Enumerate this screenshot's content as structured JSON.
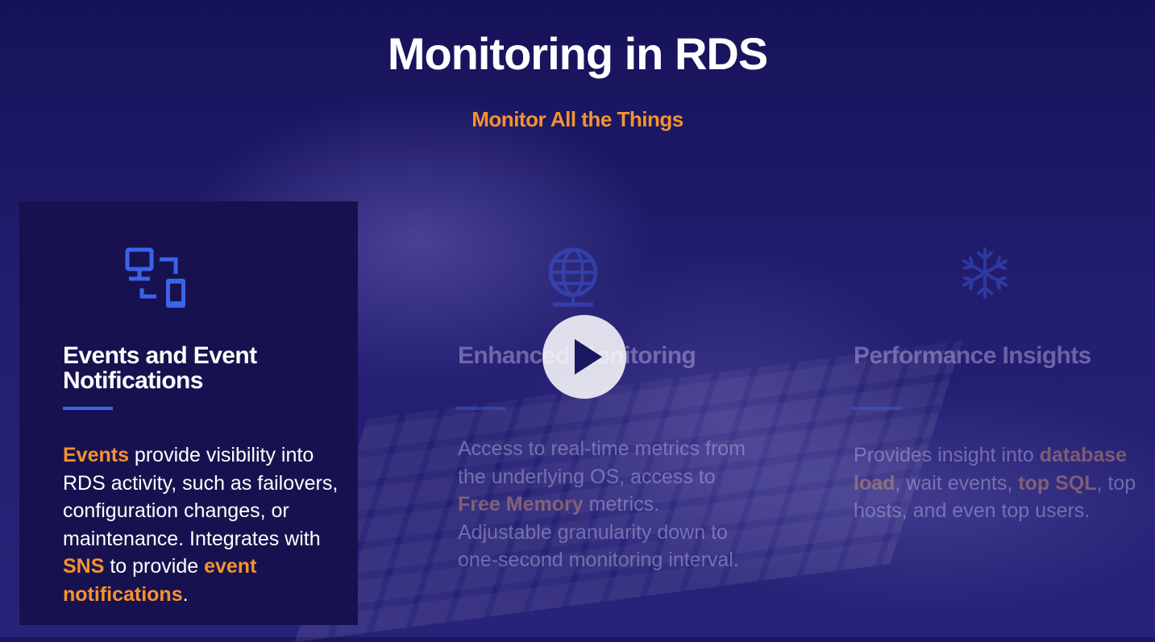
{
  "title": "Monitoring in RDS",
  "subtitle": "Monitor All the Things",
  "colors": {
    "accent": "#f5922f",
    "icon_blue": "#3b63e8",
    "background": "#1b1760"
  },
  "cards": [
    {
      "icon": "devices-icon",
      "title": "Events and Event Notifications",
      "body": [
        {
          "text": "Events",
          "highlight": true
        },
        {
          "text": " provide visibility into RDS activity, such as failovers, configuration changes, or maintenance. Integrates with ",
          "highlight": false
        },
        {
          "text": "SNS",
          "highlight": true
        },
        {
          "text": " to provide ",
          "highlight": false
        },
        {
          "text": "event notifications",
          "highlight": true
        },
        {
          "text": ".",
          "highlight": false
        }
      ]
    },
    {
      "icon": "globe-icon",
      "title": "Enhanced Monitoring",
      "body": [
        {
          "text": "Access to real-time metrics from the underlying OS, access to ",
          "highlight": false
        },
        {
          "text": "Free Memory",
          "highlight": true
        },
        {
          "text": " metrics. Adjustable granularity down to one-second monitoring interval.",
          "highlight": false
        }
      ]
    },
    {
      "icon": "snowflake-icon",
      "title": "Performance Insights",
      "body": [
        {
          "text": "Provides insight into ",
          "highlight": false
        },
        {
          "text": "database load",
          "highlight": true
        },
        {
          "text": ", wait events, ",
          "highlight": false
        },
        {
          "text": "top SQL",
          "highlight": true
        },
        {
          "text": ", top hosts, and even top users.",
          "highlight": false
        }
      ]
    }
  ],
  "play_button": {
    "icon": "play-icon"
  }
}
